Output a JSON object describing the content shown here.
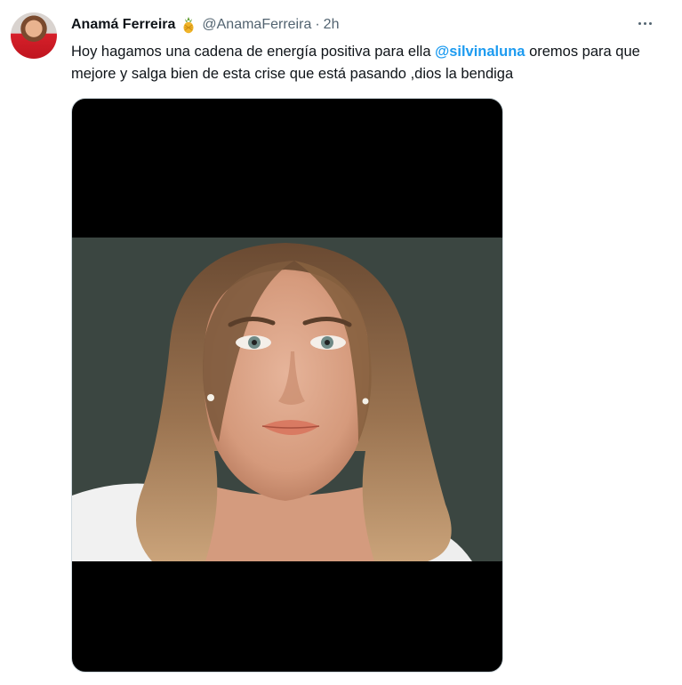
{
  "tweet": {
    "display_name": "Anamá Ferreira",
    "emoji_icon": "pineapple-icon",
    "handle": "@AnamaFerreira",
    "separator": "·",
    "time": "2h",
    "text_before": "Hoy hagamos una cadena de energía positiva para ella ",
    "mention": "@silvinaluna",
    "text_after": " oremos para que mejore y salga bien de esta crise que está pasando ,dios la bendiga",
    "more_icon": "more-horizontal-icon"
  },
  "colors": {
    "text": "#0f1419",
    "secondary": "#536471",
    "link": "#1d9bf0",
    "media_background": "#000000"
  }
}
